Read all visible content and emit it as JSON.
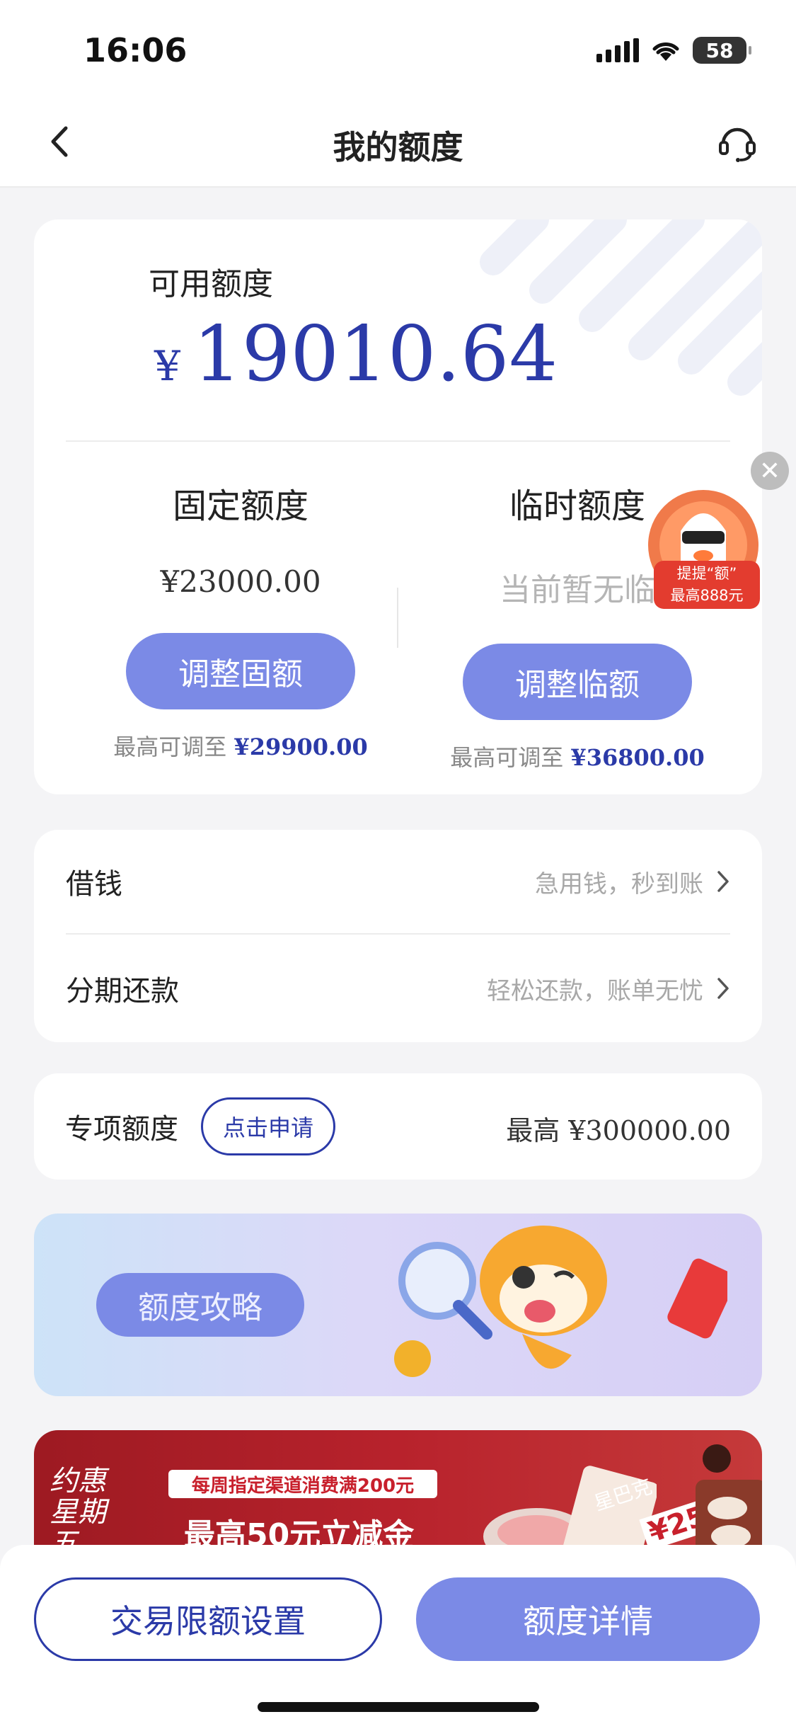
{
  "status_bar": {
    "time": "16:06",
    "battery": "58"
  },
  "nav": {
    "title": "我的额度"
  },
  "quota": {
    "available_label": "可用额度",
    "currency": "¥",
    "available_amount": "19010.64",
    "fixed": {
      "title": "固定额度",
      "value": "¥23000.00",
      "button": "调整固额",
      "max_prefix": "最高可调至 ",
      "max_value": "¥29900.00"
    },
    "temporary": {
      "title": "临时额度",
      "value": "当前暂无临",
      "button": "调整临额",
      "max_prefix": "最高可调至 ",
      "max_value": "¥36800.00"
    }
  },
  "floating_promo": {
    "line1": "提提“额”",
    "line2": "最高888元"
  },
  "menu": [
    {
      "title": "借钱",
      "hint": "急用钱，秒到账"
    },
    {
      "title": "分期还款",
      "hint": "轻松还款，账单无忧"
    }
  ],
  "special": {
    "title": "专项额度",
    "tag": "点击申请",
    "max_label": "最高 ",
    "max_value": "¥300000.00"
  },
  "banner_strategy": {
    "label": "额度攻略"
  },
  "banner_promo": {
    "line1": "每周指定渠道消费满200元",
    "line2": "最高50元立减金",
    "corner_text": "约惠星期五",
    "brand": "星巴克",
    "price": "¥25"
  },
  "bottom": {
    "limit_button": "交易限额设置",
    "detail_button": "额度详情"
  },
  "colors": {
    "accent": "#2b3aa8",
    "button": "#7b8ae6",
    "background": "#f4f4f6",
    "promo_red": "#b8222c"
  }
}
